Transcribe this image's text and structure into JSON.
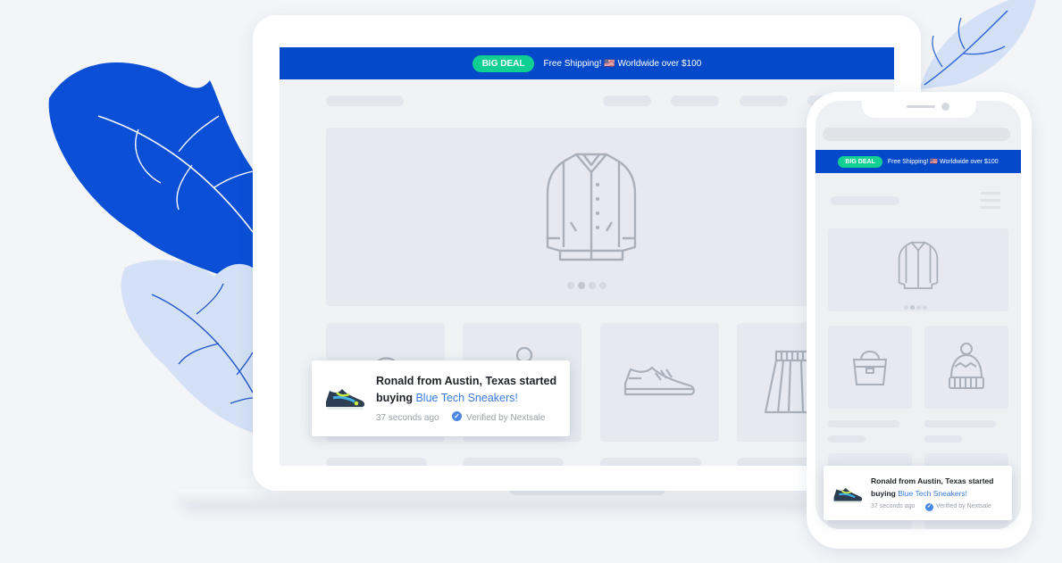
{
  "promo": {
    "badge": "BIG DEAL",
    "text": "Free Shipping! 🇺🇸 Worldwide over $100"
  },
  "notification": {
    "message_prefix": "Ronald from Austin, Texas started buying ",
    "product": "Blue Tech Sneakers!",
    "time": "37 seconds ago",
    "verified": "Verified by Nextsale"
  },
  "carousel": {
    "dot_count": 4,
    "active_index": 1
  },
  "icons": {
    "hero": "jacket-icon",
    "products": [
      "handbag-icon",
      "beanie-icon",
      "sneaker-icon",
      "skirt-icon"
    ],
    "menu": "hamburger-menu-icon"
  },
  "colors": {
    "brand_blue": "#0349c9",
    "badge_green": "#10cf92",
    "link_blue": "#3a7be0",
    "leaf_dark": "#0a4fd6",
    "leaf_light": "#d3e0f5"
  }
}
